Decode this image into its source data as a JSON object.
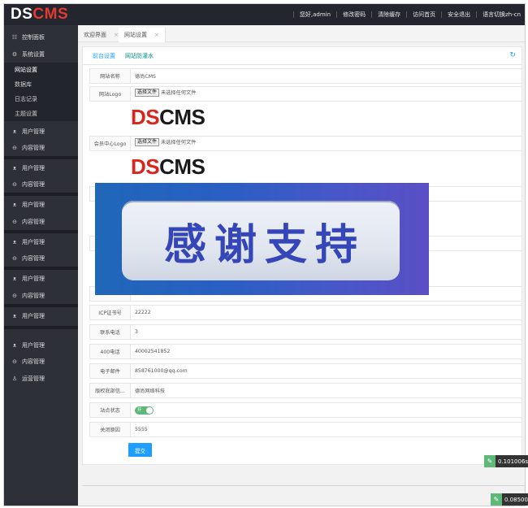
{
  "header": {
    "logo_ds": "DS",
    "logo_cms": "CMS",
    "nav": [
      "您好,admin",
      "修改密码",
      "清除缓存",
      "访问首页",
      "安全退出",
      "语言切换zh-cn"
    ]
  },
  "sidebar": {
    "dashboard": "控制面板",
    "system": "系统设置",
    "system_sub": [
      "网站设置",
      "数据库",
      "日志记录",
      "主题设置"
    ],
    "user_mgmt": "用户管理",
    "content_mgmt": "内容管理",
    "ops_mgmt": "运营管理",
    "icons": {
      "dashboard": "grid-icon",
      "system": "gear-icon",
      "user": "users-icon",
      "content": "circle-minus-icon",
      "ops": "person-icon"
    }
  },
  "tabs": [
    {
      "label": "欢迎界面",
      "close": "×"
    },
    {
      "label": "网站设置",
      "close": "×"
    }
  ],
  "subtabs": {
    "front": "前台设置",
    "protect": "网站防灌水"
  },
  "form": {
    "site_name_label": "网站名称",
    "site_name_value": "德尚CMS",
    "logo_label": "网站Logo",
    "file_button": "选择文件",
    "file_none": "未选择任何文件",
    "member_logo_label": "会员中心Logo",
    "brand_ds": "DS",
    "brand_cms": "CMS",
    "icp_label": "ICP证书号",
    "icp_value": "22222",
    "phone_label": "联系电话",
    "phone_value": "3",
    "tel400_label": "400电话",
    "tel400_value": "40002541852",
    "email_label": "电子邮件",
    "email_value": "858761000@qq.com",
    "copyright_label": "版权底部信...",
    "copyright_value": "德尚网络科技",
    "status_label": "站点状态",
    "status_toggle": "开",
    "close_reason_label": "关闭原因",
    "close_reason_value": "5555",
    "submit": "提交"
  },
  "banner": {
    "text": "感谢支持"
  },
  "timers": [
    "0.101006s",
    "0.08500"
  ],
  "colors": {
    "accent": "#1e9fff",
    "header": "#23262e",
    "sidebar": "#2d3037",
    "toggle_on": "#5fb878",
    "logo_red": "#d9251c"
  }
}
